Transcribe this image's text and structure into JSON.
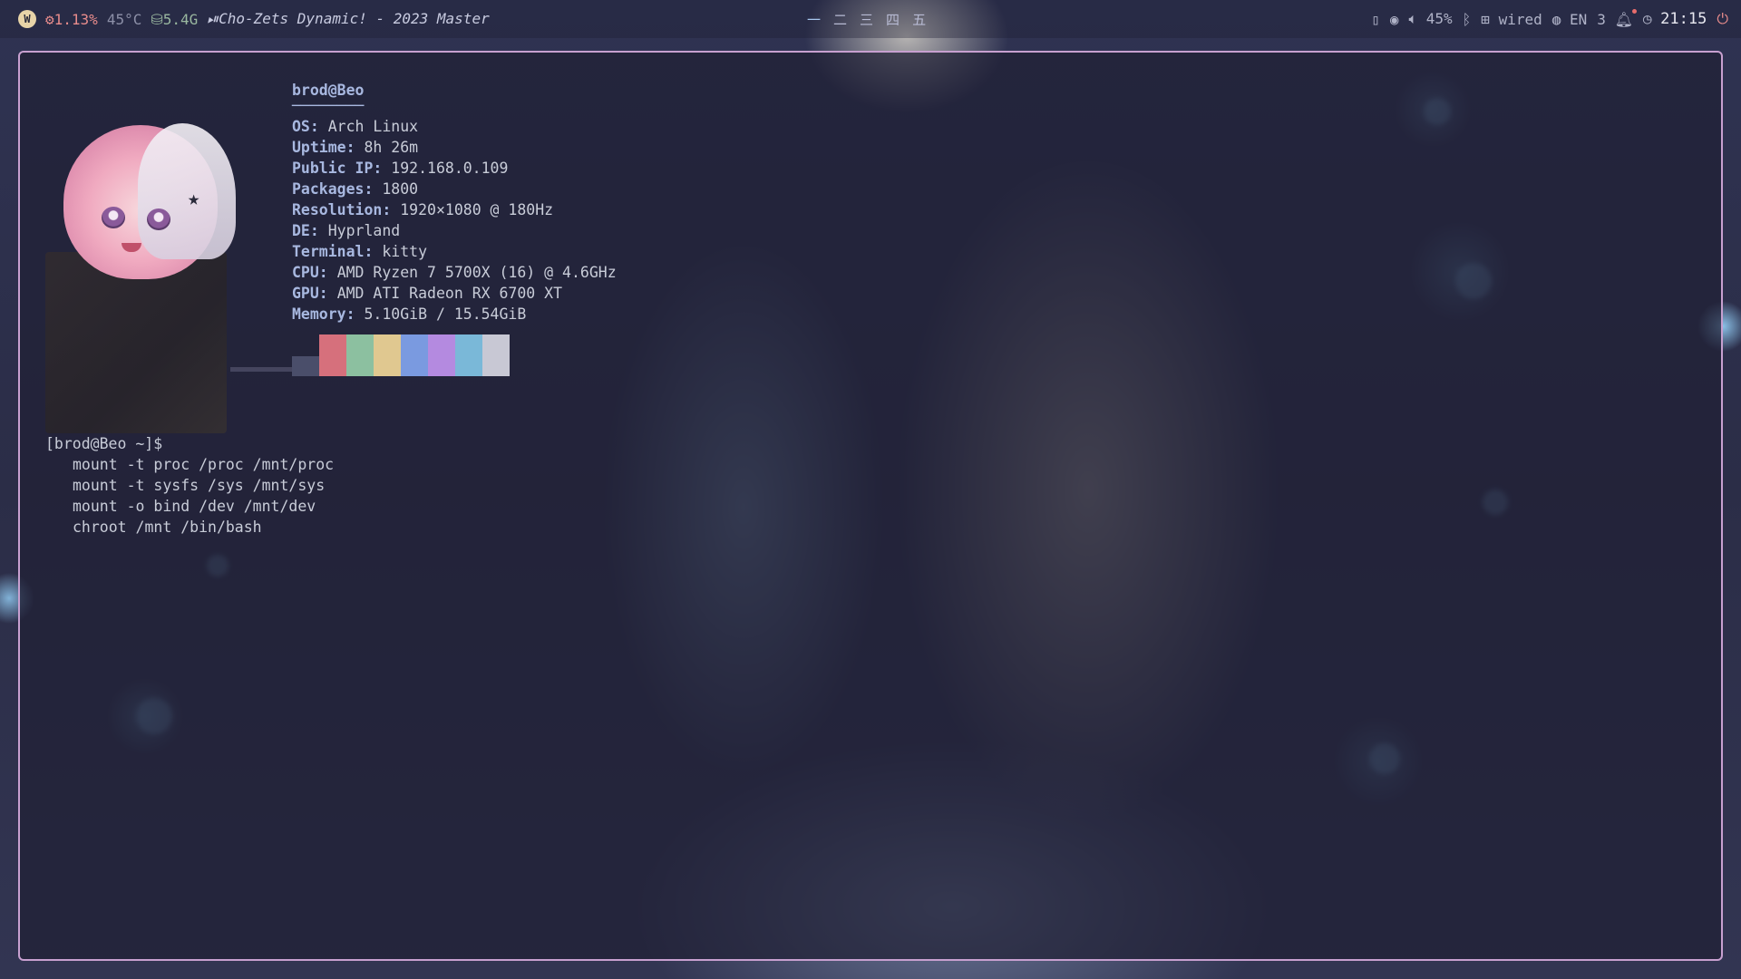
{
  "topbar": {
    "logo_label": "W",
    "cpu": "1.13%",
    "temp": "45°C",
    "disk": "5.4G",
    "media_icon": "⏯",
    "media_title": "Cho-Zets Dynamic! - 2023 Master",
    "workspaces": [
      "一",
      "二",
      "三",
      "四",
      "五"
    ],
    "volume": "45%",
    "network": "wired",
    "language": "EN",
    "notification_count": "3",
    "clock": "21:15"
  },
  "terminal": {
    "fetch": {
      "title": "brod@Beo",
      "underline": "────────",
      "rows": [
        {
          "key": "OS:",
          "value": "Arch Linux"
        },
        {
          "key": "Uptime:",
          "value": "8h 26m"
        },
        {
          "key": "Public IP:",
          "value": "192.168.0.109"
        },
        {
          "key": "Packages:",
          "value": "1800"
        },
        {
          "key": "Resolution:",
          "value": "1920×1080 @ 180Hz"
        },
        {
          "key": "DE:",
          "value": "Hyprland"
        },
        {
          "key": "Terminal:",
          "value": "kitty"
        },
        {
          "key": "CPU:",
          "value": "AMD Ryzen 7 5700X (16) @ 4.6GHz"
        },
        {
          "key": "GPU:",
          "value": "AMD ATI Radeon RX 6700 XT"
        },
        {
          "key": "Memory:",
          "value": "5.10GiB / 15.54GiB"
        }
      ],
      "palette": [
        "#4a4e6a",
        "#d6707c",
        "#8cc0a0",
        "#e0c890",
        "#7a9ae0",
        "#b48ae0",
        "#7ab8d8",
        "#c8c8d4"
      ]
    },
    "prompt": "[brod@Beo ~]$",
    "commands": [
      "mount -t proc /proc /mnt/proc",
      "mount -t sysfs /sys /mnt/sys",
      "mount -o bind /dev /mnt/dev",
      "chroot /mnt /bin/bash"
    ]
  }
}
